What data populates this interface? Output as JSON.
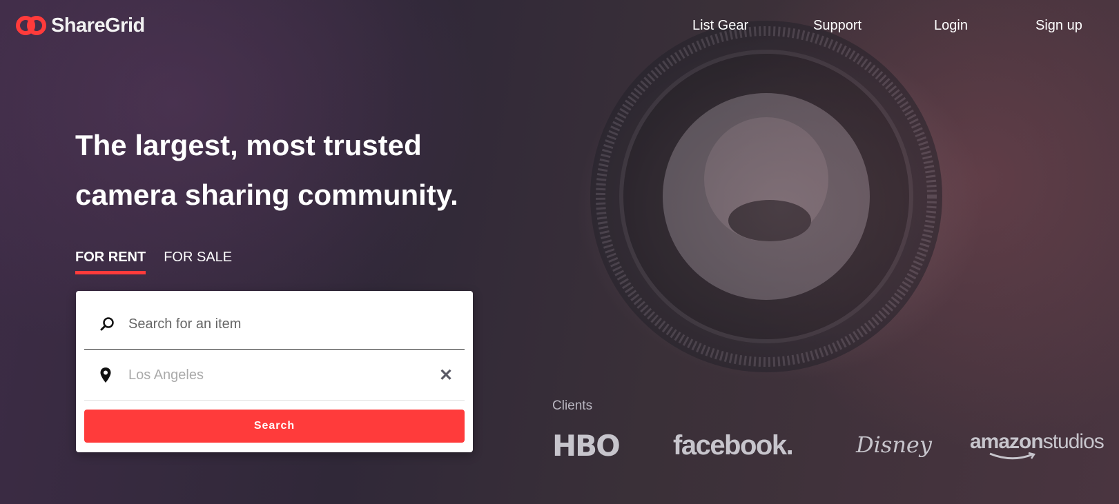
{
  "brand": {
    "name": "ShareGrid",
    "accent": "#ff3b3b"
  },
  "nav": {
    "list_gear": "List Gear",
    "support": "Support",
    "login": "Login",
    "signup": "Sign up"
  },
  "hero": {
    "line1": "The largest, most trusted",
    "line2": "camera sharing community."
  },
  "tabs": [
    {
      "label": "FOR RENT",
      "active": true
    },
    {
      "label": "FOR SALE",
      "active": false
    }
  ],
  "search": {
    "item_placeholder": "Search for an item",
    "item_value": "",
    "location_placeholder": "Los Angeles",
    "location_value": "",
    "button_label": "Search",
    "item_icon": "search-icon",
    "location_icon": "map-pin-icon",
    "clear_icon": "close-icon"
  },
  "clients": {
    "label": "Clients",
    "logos": [
      "HBO",
      "facebook.",
      "Disney",
      "amazon",
      "studios"
    ]
  }
}
